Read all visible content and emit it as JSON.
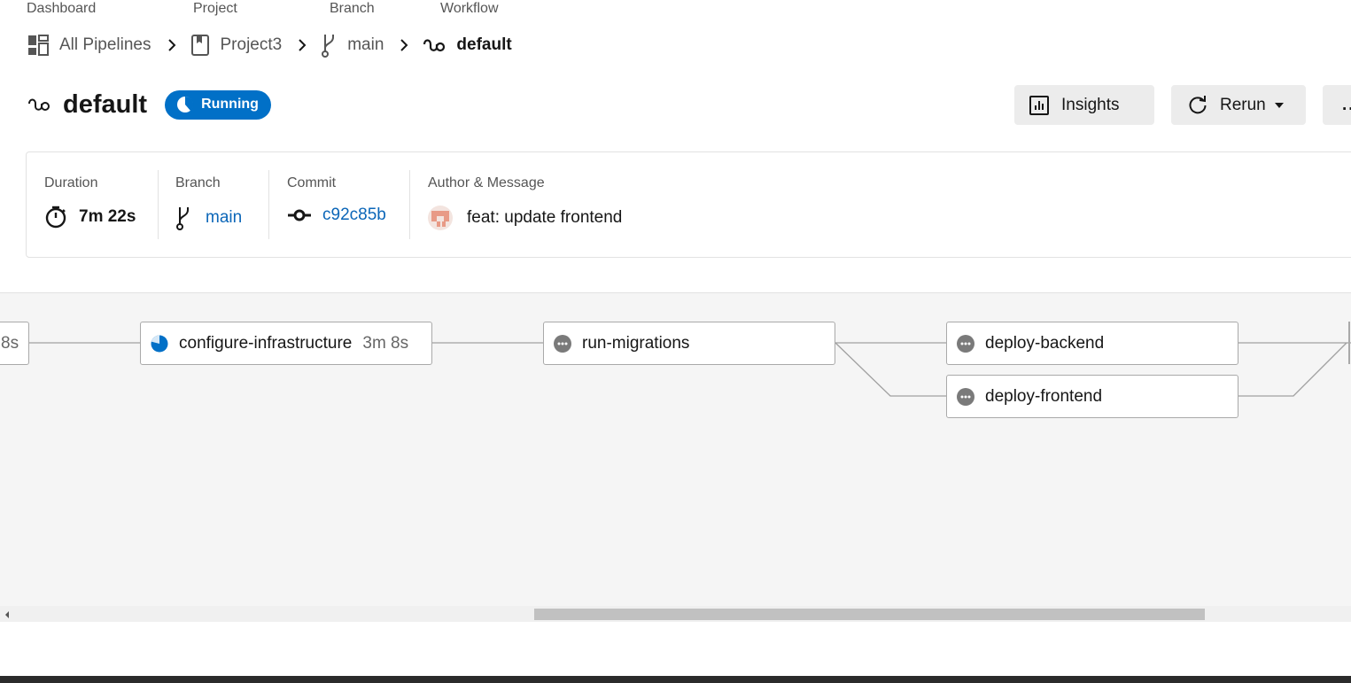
{
  "breadcrumb_labels": {
    "dashboard": "Dashboard",
    "project": "Project",
    "branch": "Branch",
    "workflow": "Workflow"
  },
  "breadcrumbs": {
    "dashboard": "All Pipelines",
    "project": "Project3",
    "branch": "main",
    "workflow": "default"
  },
  "header": {
    "title": "default",
    "status": "Running",
    "status_color": "#0170c7"
  },
  "actions": {
    "insights": "Insights",
    "rerun": "Rerun",
    "more": "..."
  },
  "info": {
    "duration_label": "Duration",
    "duration": "7m 22s",
    "branch_label": "Branch",
    "branch": "main",
    "commit_label": "Commit",
    "commit": "c92c85b",
    "author_label": "Author & Message",
    "message": "feat: update frontend"
  },
  "jobs": {
    "previous": {
      "duration": "8s"
    },
    "configure": {
      "name": "configure-infrastructure",
      "duration": "3m 8s",
      "status": "running"
    },
    "migrations": {
      "name": "run-migrations",
      "status": "not-run"
    },
    "backend": {
      "name": "deploy-backend",
      "status": "not-run"
    },
    "frontend": {
      "name": "deploy-frontend",
      "status": "not-run"
    }
  },
  "colors": {
    "link": "#0b66b8",
    "running": "#0170c7",
    "not_run_icon": "#7a7a7a"
  }
}
